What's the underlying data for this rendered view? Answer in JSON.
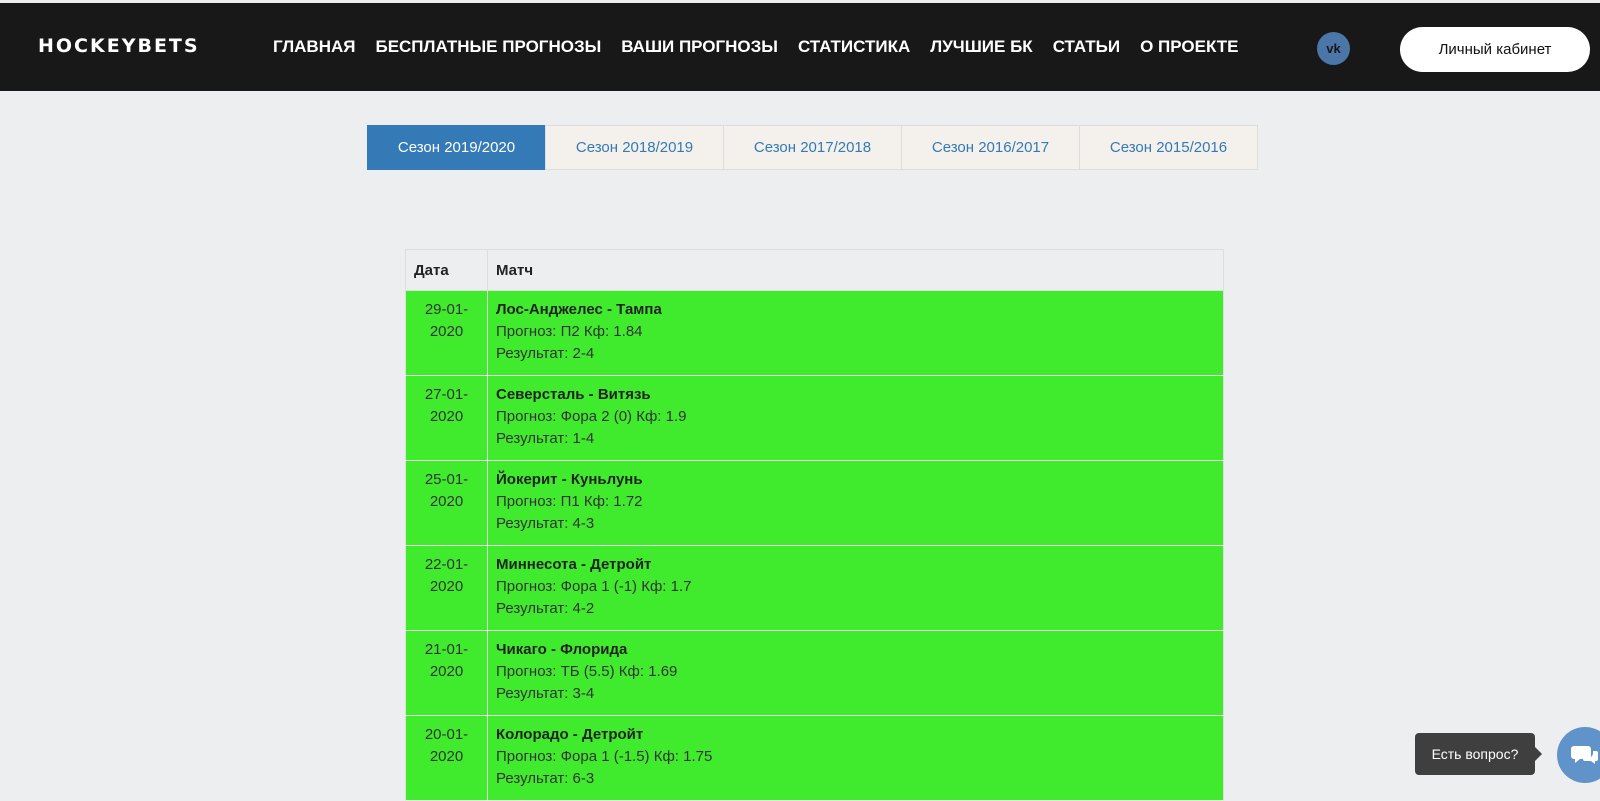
{
  "header": {
    "logo": "HOCKEYBETS",
    "nav": [
      {
        "label": "ГЛАВНАЯ"
      },
      {
        "label": "БЕСПЛАТНЫЕ ПРОГНОЗЫ"
      },
      {
        "label": "ВАШИ ПРОГНОЗЫ"
      },
      {
        "label": "СТАТИСТИКА"
      },
      {
        "label": "ЛУЧШИЕ БК"
      },
      {
        "label": "СТАТЬИ"
      },
      {
        "label": "О ПРОЕКТЕ"
      }
    ],
    "vk_icon": "vk-icon",
    "vk_text": "vk",
    "cabinet_label": "Личный кабинет"
  },
  "seasons": [
    {
      "label": "Сезон 2019/2020",
      "active": true
    },
    {
      "label": "Сезон 2018/2019",
      "active": false
    },
    {
      "label": "Сезон 2017/2018",
      "active": false
    },
    {
      "label": "Сезон 2016/2017",
      "active": false
    },
    {
      "label": "Сезон 2015/2016",
      "active": false
    }
  ],
  "table": {
    "headers": {
      "date": "Дата",
      "match": "Матч"
    },
    "rows": [
      {
        "date_line1": "29-01-",
        "date_line2": "2020",
        "title": "Лос-Анджелес - Тампа",
        "forecast": "Прогноз: П2 Кф: 1.84",
        "result": "Результат: 2-4"
      },
      {
        "date_line1": "27-01-",
        "date_line2": "2020",
        "title": "Северсталь - Витязь",
        "forecast": "Прогноз: Фора 2 (0) Кф: 1.9",
        "result": "Результат: 1-4"
      },
      {
        "date_line1": "25-01-",
        "date_line2": "2020",
        "title": "Йокерит - Куньлунь",
        "forecast": "Прогноз: П1 Кф: 1.72",
        "result": "Результат: 4-3"
      },
      {
        "date_line1": "22-01-",
        "date_line2": "2020",
        "title": "Миннесота - Детройт",
        "forecast": "Прогноз: Фора 1 (-1) Кф: 1.7",
        "result": "Результат: 4-2"
      },
      {
        "date_line1": "21-01-",
        "date_line2": "2020",
        "title": "Чикаго - Флорида",
        "forecast": "Прогноз: ТБ (5.5) Кф: 1.69",
        "result": "Результат: 3-4"
      },
      {
        "date_line1": "20-01-",
        "date_line2": "2020",
        "title": "Колорадо - Детройт",
        "forecast": "Прогноз: Фора 1 (-1.5) Кф: 1.75",
        "result": "Результат: 6-3"
      }
    ],
    "win_color": "#40eb2d"
  },
  "chat": {
    "label": "Есть вопрос?",
    "icon": "chat-bubbles-icon"
  },
  "colors": {
    "header_bg": "#181818",
    "accent": "#337ab7"
  }
}
